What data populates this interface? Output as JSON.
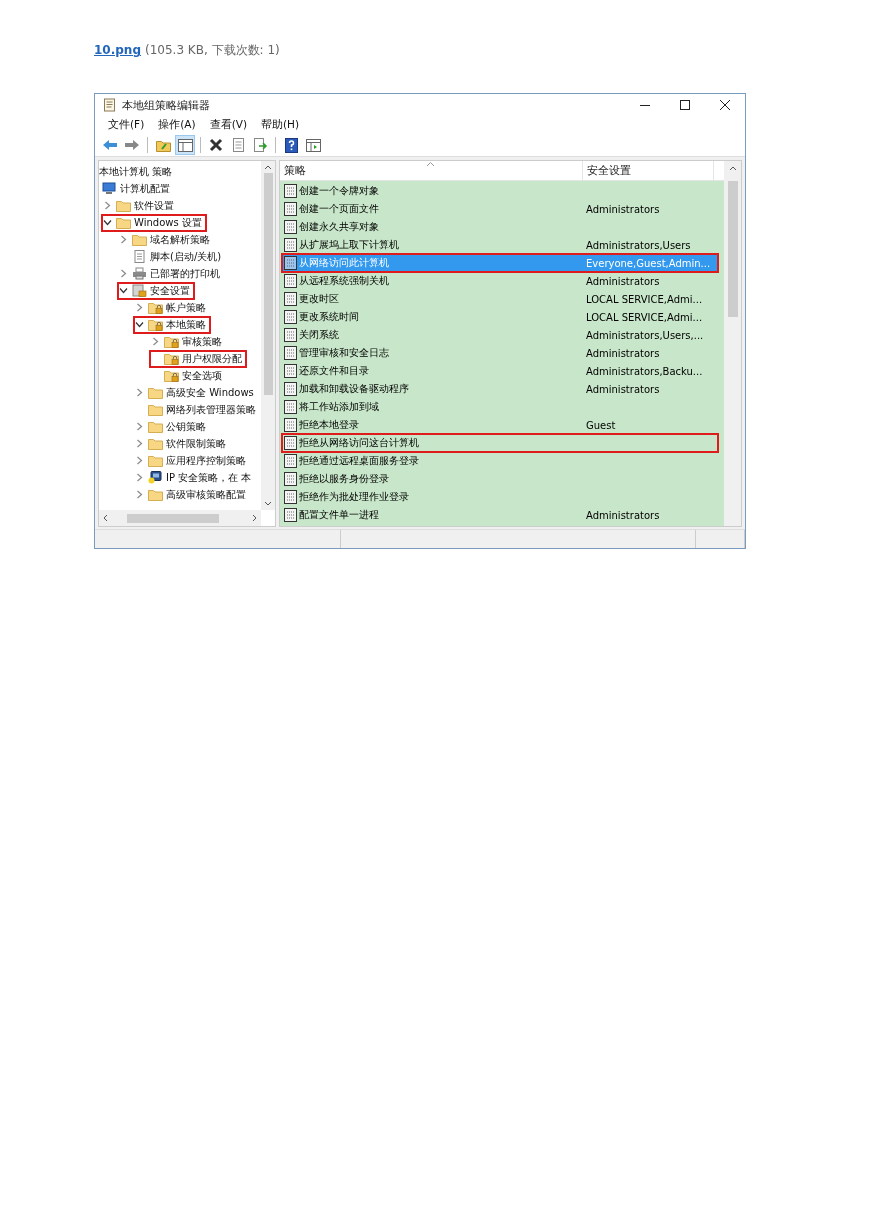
{
  "attachment": {
    "file_link": "10.png",
    "info": "(105.3 KB, 下载次数: 1)"
  },
  "window": {
    "title": "本地组策略编辑器"
  },
  "menu": [
    "文件(F)",
    "操作(A)",
    "查看(V)",
    "帮助(H)"
  ],
  "tree": [
    {
      "label": "本地计算机 策略",
      "highlighted": false,
      "children": [
        {
          "label": "计算机配置",
          "kind": "computer",
          "highlighted": false,
          "children": [
            {
              "label": "软件设置",
              "expanded": false,
              "kind": "folder",
              "highlighted": false
            },
            {
              "label": "Windows 设置",
              "expanded": true,
              "kind": "folder",
              "highlighted": true,
              "children": [
                {
                  "label": "域名解析策略",
                  "expanded": false,
                  "kind": "folder",
                  "highlighted": false
                },
                {
                  "label": "脚本(启动/关机)",
                  "kind": "script",
                  "highlighted": false
                },
                {
                  "label": "已部署的打印机",
                  "expanded": false,
                  "kind": "printer",
                  "highlighted": false
                },
                {
                  "label": "安全设置",
                  "expanded": true,
                  "kind": "security",
                  "highlighted": true,
                  "children": [
                    {
                      "label": "帐户策略",
                      "expanded": false,
                      "kind": "lock-folder",
                      "highlighted": false
                    },
                    {
                      "label": "本地策略",
                      "expanded": true,
                      "kind": "lock-folder",
                      "highlighted": true,
                      "children": [
                        {
                          "label": "审核策略",
                          "expanded": false,
                          "kind": "lock-folder",
                          "highlighted": false
                        },
                        {
                          "label": "用户权限分配",
                          "kind": "lock-folder",
                          "highlighted": true
                        },
                        {
                          "label": "安全选项",
                          "kind": "lock-folder",
                          "highlighted": false
                        }
                      ]
                    },
                    {
                      "label": "高级安全 Windows",
                      "expanded": false,
                      "kind": "folder",
                      "highlighted": false
                    },
                    {
                      "label": "网络列表管理器策略",
                      "kind": "folder",
                      "highlighted": false
                    },
                    {
                      "label": "公钥策略",
                      "expanded": false,
                      "kind": "folder",
                      "highlighted": false
                    },
                    {
                      "label": "软件限制策略",
                      "expanded": false,
                      "kind": "folder",
                      "highlighted": false
                    },
                    {
                      "label": "应用程序控制策略",
                      "expanded": false,
                      "kind": "folder",
                      "highlighted": false
                    },
                    {
                      "label": "IP 安全策略，在 本",
                      "expanded": false,
                      "kind": "ip",
                      "highlighted": false
                    },
                    {
                      "label": "高级审核策略配置",
                      "expanded": false,
                      "kind": "folder",
                      "highlighted": false
                    }
                  ]
                }
              ]
            }
          ]
        }
      ]
    }
  ],
  "columns": [
    "策略",
    "安全设置"
  ],
  "policies": [
    {
      "name": "创建一个令牌对象",
      "selected": false,
      "highlighted": false
    },
    {
      "name": "创建一个页面文件",
      "setting": "Administrators",
      "selected": false,
      "highlighted": false
    },
    {
      "name": "创建永久共享对象",
      "selected": false,
      "highlighted": false
    },
    {
      "name": "从扩展坞上取下计算机",
      "setting": "Administrators,Users",
      "selected": false,
      "highlighted": false
    },
    {
      "name": "从网络访问此计算机",
      "setting": "Everyone,Guest,Admin...",
      "selected": true,
      "highlighted": true
    },
    {
      "name": "从远程系统强制关机",
      "setting": "Administrators",
      "selected": false,
      "highlighted": false
    },
    {
      "name": "更改时区",
      "setting": "LOCAL SERVICE,Admi...",
      "selected": false,
      "highlighted": false
    },
    {
      "name": "更改系统时间",
      "setting": "LOCAL SERVICE,Admi...",
      "selected": false,
      "highlighted": false
    },
    {
      "name": "关闭系统",
      "setting": "Administrators,Users,...",
      "selected": false,
      "highlighted": false
    },
    {
      "name": "管理审核和安全日志",
      "setting": "Administrators",
      "selected": false,
      "highlighted": false
    },
    {
      "name": "还原文件和目录",
      "setting": "Administrators,Backu...",
      "selected": false,
      "highlighted": false
    },
    {
      "name": "加载和卸载设备驱动程序",
      "setting": "Administrators",
      "selected": false,
      "highlighted": false
    },
    {
      "name": "将工作站添加到域",
      "selected": false,
      "highlighted": false
    },
    {
      "name": "拒绝本地登录",
      "setting": "Guest",
      "selected": false,
      "highlighted": false
    },
    {
      "name": "拒绝从网络访问这台计算机",
      "selected": false,
      "highlighted": true
    },
    {
      "name": "拒绝通过远程桌面服务登录",
      "selected": false,
      "highlighted": false
    },
    {
      "name": "拒绝以服务身份登录",
      "selected": false,
      "highlighted": false
    },
    {
      "name": "拒绝作为批处理作业登录",
      "selected": false,
      "highlighted": false
    },
    {
      "name": "配置文件单一进程",
      "setting": "Administrators",
      "selected": false,
      "highlighted": false
    }
  ]
}
